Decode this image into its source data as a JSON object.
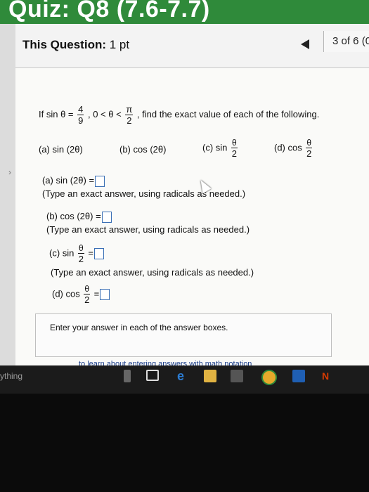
{
  "window": {
    "title": "Quiz: Q8 (7.6-7.7)"
  },
  "question_header": {
    "label": "This Question:",
    "value": "1 pt",
    "counter": "3 of 6 (0"
  },
  "problem": {
    "prefix": "If sin θ =",
    "frac1_num": "4",
    "frac1_den": "9",
    "mid": ", 0 < θ <",
    "frac2_num": "π",
    "frac2_den": "2",
    "suffix": ", find the exact value of each of the following.",
    "parts": [
      {
        "label": "(a) sin (2θ)"
      },
      {
        "label": "(b) cos (2θ)"
      },
      {
        "label_prefix": "(c) sin",
        "num": "θ",
        "den": "2"
      },
      {
        "label_prefix": "(d) cos",
        "num": "θ",
        "den": "2"
      }
    ]
  },
  "answers": {
    "a": {
      "label": "(a) sin (2θ) =",
      "instruction": "(Type an exact answer, using radicals as needed.)"
    },
    "b": {
      "label": "(b) cos (2θ) =",
      "instruction": "(Type an exact answer, using radicals as needed.)"
    },
    "c": {
      "label_prefix": "(c) sin",
      "num": "θ",
      "den": "2",
      "equals": "=",
      "instruction": "(Type an exact answer, using radicals as needed.)"
    },
    "d": {
      "label_prefix": "(d) cos",
      "num": "θ",
      "den": "2",
      "equals": "="
    }
  },
  "footer": {
    "message": "Enter your answer in each of the answer boxes.",
    "link": "to learn about entering answers with math notation"
  },
  "taskbar": {
    "search_text": "ything"
  },
  "colors": {
    "title_bar": "#2f8a3a",
    "answer_box_border": "#3a6fb5"
  }
}
